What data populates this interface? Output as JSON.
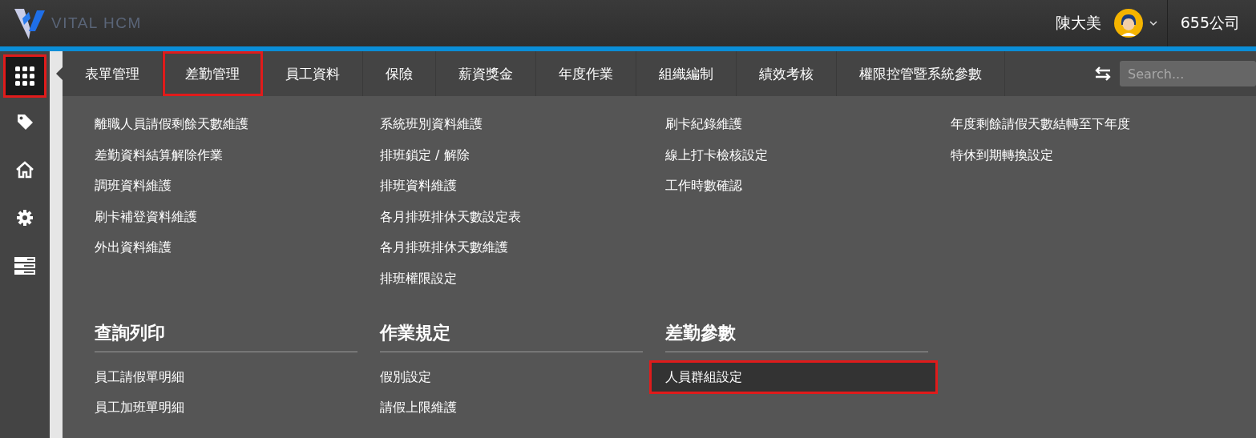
{
  "header": {
    "logo_text": "VITAL HCM",
    "user_name": "陳大美",
    "company": "655公司"
  },
  "sidebar": {
    "items": [
      {
        "kind": "grid",
        "selected": true
      },
      {
        "kind": "tag",
        "selected": false
      },
      {
        "kind": "home",
        "selected": false
      },
      {
        "kind": "gear",
        "selected": false
      },
      {
        "kind": "server",
        "selected": false
      }
    ]
  },
  "tabs": [
    {
      "label": "表單管理",
      "selected": false
    },
    {
      "label": "差勤管理",
      "selected": true
    },
    {
      "label": "員工資料",
      "selected": false
    },
    {
      "label": "保險",
      "selected": false
    },
    {
      "label": "薪資獎金",
      "selected": false
    },
    {
      "label": "年度作業",
      "selected": false
    },
    {
      "label": "組織編制",
      "selected": false
    },
    {
      "label": "績效考核",
      "selected": false
    },
    {
      "label": "權限控管暨系統參數",
      "selected": false
    }
  ],
  "search": {
    "placeholder": "Search..."
  },
  "columns": [
    {
      "items": [
        {
          "label": "離職人員請假剩餘天數維護",
          "selected": false
        },
        {
          "label": "差勤資料結算解除作業",
          "selected": false
        },
        {
          "label": "調班資料維護",
          "selected": false
        },
        {
          "label": "刷卡補登資料維護",
          "selected": false
        },
        {
          "label": "外出資料維護",
          "selected": false
        }
      ]
    },
    {
      "items": [
        {
          "label": "系統班別資料維護",
          "selected": false
        },
        {
          "label": "排班鎖定 / 解除",
          "selected": false
        },
        {
          "label": "排班資料維護",
          "selected": false
        },
        {
          "label": "各月排班排休天數設定表",
          "selected": false
        },
        {
          "label": "各月排班排休天數維護",
          "selected": false
        },
        {
          "label": "排班權限設定",
          "selected": false
        }
      ]
    },
    {
      "items": [
        {
          "label": "刷卡紀錄維護",
          "selected": false
        },
        {
          "label": "線上打卡檢核設定",
          "selected": false
        },
        {
          "label": "工作時數確認",
          "selected": false
        }
      ]
    },
    {
      "items": [
        {
          "label": "年度剩餘請假天數結轉至下年度",
          "selected": false
        },
        {
          "label": "特休到期轉換設定",
          "selected": false
        }
      ]
    }
  ],
  "sections": [
    {
      "title": "查詢列印",
      "items": [
        {
          "label": "員工請假單明細",
          "selected": false
        },
        {
          "label": "員工加班單明細",
          "selected": false
        }
      ]
    },
    {
      "title": "作業規定",
      "items": [
        {
          "label": "假別設定",
          "selected": false
        },
        {
          "label": "請假上限維護",
          "selected": false
        }
      ]
    },
    {
      "title": "差勤參數",
      "items": [
        {
          "label": "人員群組設定",
          "selected": true
        }
      ]
    }
  ]
}
